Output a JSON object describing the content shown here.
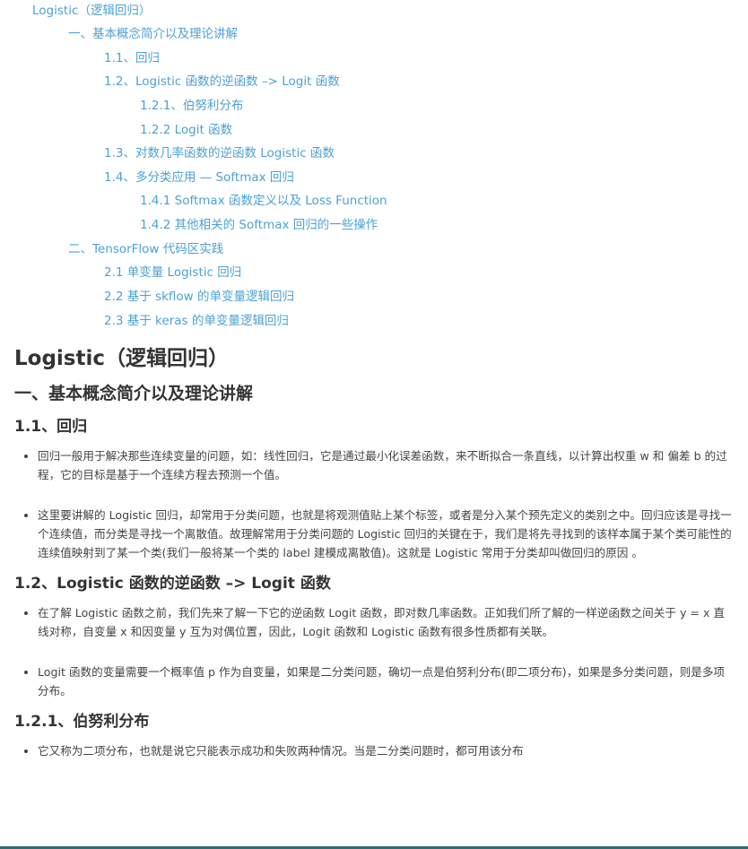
{
  "toc": [
    {
      "id": "toc-logistic",
      "text": "Logistic（逻辑回归）"
    },
    {
      "id": "toc-1",
      "text": "一、基本概念简介以及理论讲解"
    },
    {
      "id": "toc-1-1",
      "text": "1.1、回归"
    },
    {
      "id": "toc-1-2",
      "text": "1.2、Logistic 函数的逆函数 –> Logit 函数"
    },
    {
      "id": "toc-1-2-1",
      "text": "1.2.1、伯努利分布"
    },
    {
      "id": "toc-1-2-2",
      "text": "1.2.2 Logit 函数"
    },
    {
      "id": "toc-1-3",
      "text": "1.3、对数几率函数的逆函数 Logistic 函数"
    },
    {
      "id": "toc-1-4",
      "text": "1.4、多分类应用 — Softmax 回归"
    },
    {
      "id": "toc-1-4-1",
      "text": "1.4.1 Softmax 函数定义以及 Loss Function"
    },
    {
      "id": "toc-1-4-2",
      "text": "1.4.2 其他相关的 Softmax 回归的一些操作"
    },
    {
      "id": "toc-2",
      "text": "二、TensorFlow 代码区实践"
    },
    {
      "id": "toc-2-1",
      "text": "2.1 单变量 Logistic 回归"
    },
    {
      "id": "toc-2-2",
      "text": "2.2 基于 skflow 的单变量逻辑回归"
    },
    {
      "id": "toc-2-3",
      "text": "2.3 基于 keras 的单变量逻辑回归"
    }
  ],
  "article": {
    "title": "Logistic（逻辑回归）",
    "h_1": "一、基本概念简介以及理论讲解",
    "h_1_1": "1.1、回归",
    "s1_1": [
      "回归一般用于解决那些连续变量的问题，如：线性回归，它是通过最小化误差函数，来不断拟合一条直线，以计算出权重 w 和 偏差 b 的过程，它的目标是基于一个连续方程去预测一个值。",
      "这里要讲解的 Logistic 回归，却常用于分类问题，也就是将观测值贴上某个标签，或者是分入某个预先定义的类别之中。回归应该是寻找一个连续值，而分类是寻找一个离散值。故理解常用于分类问题的 Logistic 回归的关键在于，我们是将先寻找到的该样本属于某个类可能性的连续值映射到了某一个类(我们一般将某一个类的 label 建模成离散值)。这就是 Logistic 常用于分类却叫做回归的原因 。"
    ],
    "h_1_2": "1.2、Logistic 函数的逆函数 –> Logit 函数",
    "s1_2": [
      "在了解 Logistic 函数之前，我们先来了解一下它的逆函数 Logit 函数，即对数几率函数。正如我们所了解的一样逆函数之间关于 y = x 直线对称，自变量 x 和因变量 y 互为对偶位置，因此，Logit 函数和 Logistic 函数有很多性质都有关联。",
      "Logit 函数的变量需要一个概率值 p 作为自变量，如果是二分类问题，确切一点是伯努利分布(即二项分布)，如果是多分类问题，则是多项分布。"
    ],
    "h_1_2_1": "1.2.1、伯努利分布",
    "s1_2_1": [
      "它又称为二项分布，也就是说它只能表示成功和失败两种情况。当是二分类问题时，都可用该分布"
    ]
  }
}
